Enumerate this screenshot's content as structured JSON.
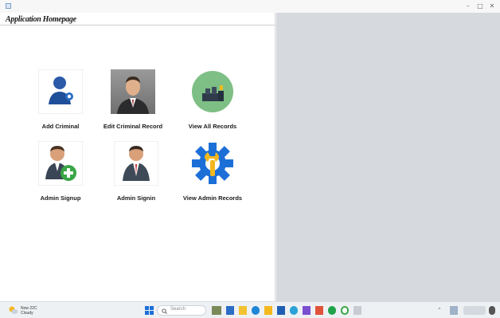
{
  "window": {
    "title": "Application Homepage",
    "controls": [
      "–",
      "□",
      "✕"
    ]
  },
  "tiles": [
    {
      "label": "Add Criminal",
      "icon": "add-criminal-icon"
    },
    {
      "label": "Edit Criminal Record",
      "icon": "businessman-portrait-icon"
    },
    {
      "label": "View All Records",
      "icon": "records-circle-icon"
    },
    {
      "label": "Admin Signup",
      "icon": "admin-add-icon"
    },
    {
      "label": "Admin Signin",
      "icon": "admin-person-icon"
    },
    {
      "label": "View Admin Records",
      "icon": "gear-wrench-icon"
    }
  ],
  "taskbar": {
    "weather": {
      "line1": "Now 22C",
      "line2": "Cloudy"
    },
    "search_placeholder": "Search",
    "apps": [
      "widgets-icon",
      "file-explorer-icon",
      "edge-icon",
      "store-icon",
      "mail-icon",
      "chrome-icon",
      "vs-icon",
      "media-icon",
      "spotify-icon",
      "settings-icon"
    ]
  },
  "colors": {
    "right_panel": "#d6d9de",
    "accent_blue": "#2b6cc4",
    "gear_blue": "#1d6fd8",
    "gear_yellow": "#f4b81e",
    "green": "#3aa546"
  }
}
